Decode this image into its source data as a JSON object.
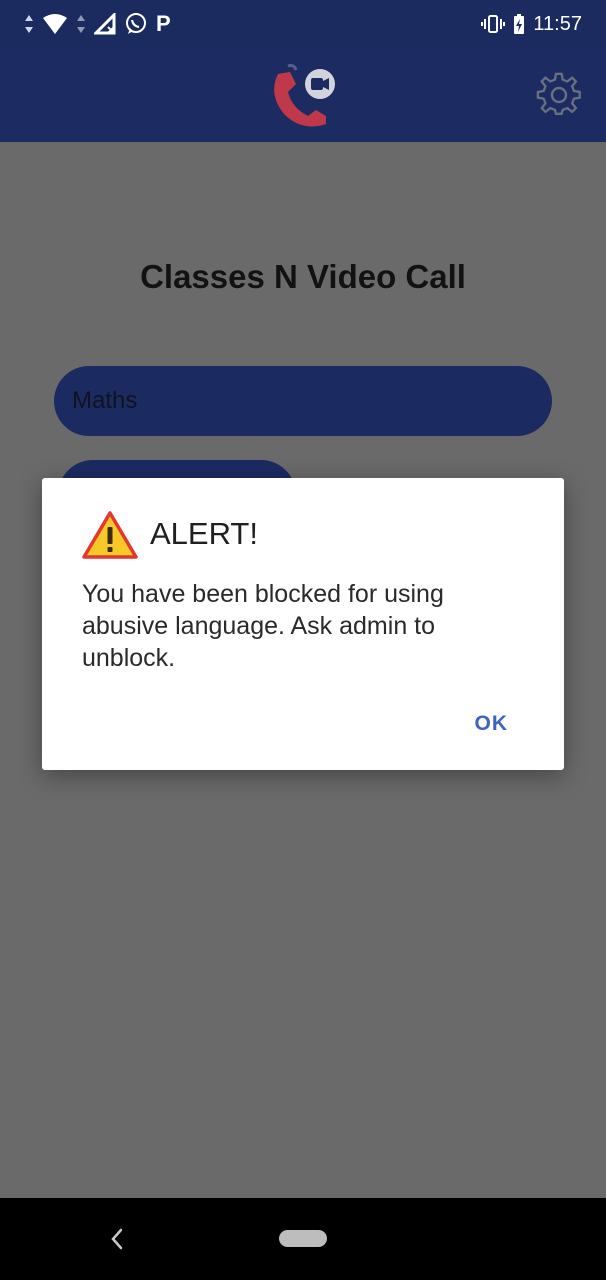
{
  "status_bar": {
    "time": "11:57",
    "icons_left": [
      "data-arrows-icon",
      "wifi-icon",
      "signal-icon",
      "whatsapp-icon",
      "parking-p-icon"
    ],
    "icons_right": [
      "vibrate-icon",
      "battery-charging-icon"
    ],
    "p_label": "P"
  },
  "app_bar": {
    "logo_icon": "phone-video-call-logo-icon",
    "settings_icon": "gear-icon"
  },
  "main": {
    "title": "Classes N Video Call",
    "classes": [
      {
        "label": "Maths"
      },
      {
        "label": ""
      }
    ]
  },
  "dialog": {
    "icon": "warning-icon",
    "title": "ALERT!",
    "message": "You have been blocked for using abusive language. Ask admin to unblock.",
    "ok_label": "OK"
  },
  "nav_bar": {
    "back_icon": "chevron-left-icon",
    "home_icon": "home-pill-icon"
  },
  "colors": {
    "primary": "#1c2c63",
    "accent": "#3e63c4",
    "scrim": "#6a6a6a"
  }
}
